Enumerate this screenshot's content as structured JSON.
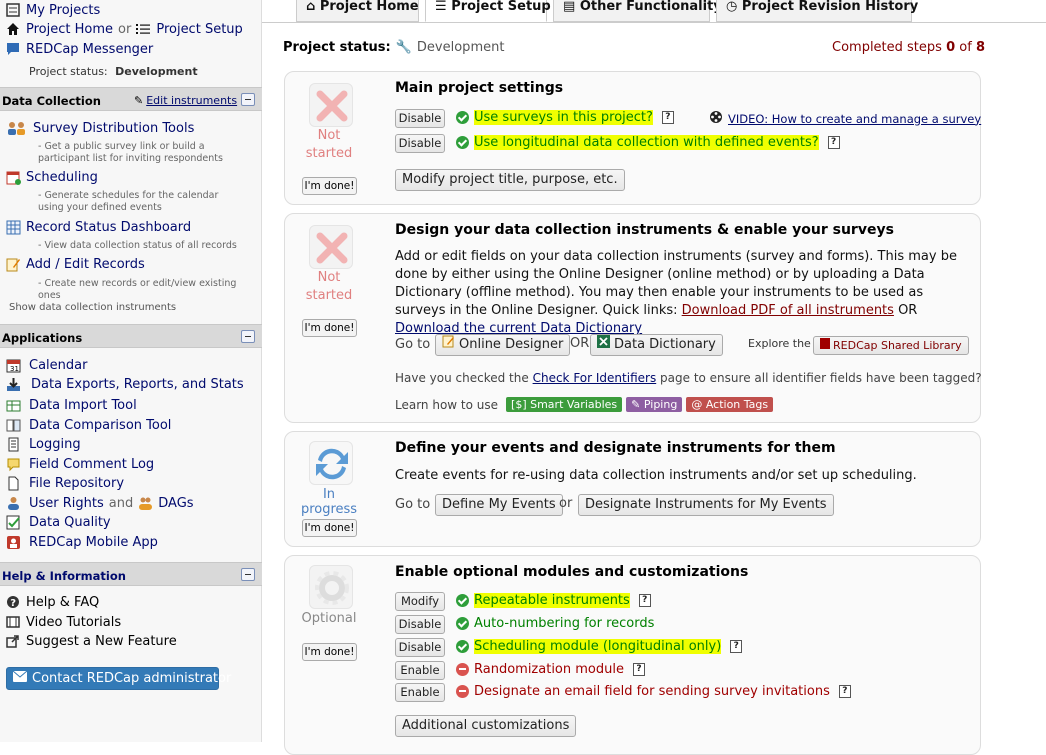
{
  "sidebar": {
    "my_projects": "My Projects",
    "project_home": "Project Home",
    "or": "or",
    "project_setup": "Project Setup",
    "messenger": "REDCap Messenger",
    "status_label": "Project status:",
    "status_value": "Development",
    "data_collection": {
      "header": "Data Collection",
      "edit_link": "Edit instruments",
      "items": [
        {
          "label": "Survey Distribution Tools",
          "sub": "- Get a public survey link or build a participant list for inviting respondents"
        },
        {
          "label": "Scheduling",
          "sub": "- Generate schedules for the calendar using your defined events"
        },
        {
          "label": "Record Status Dashboard",
          "sub": "- View data collection status of all records"
        },
        {
          "label": "Add / Edit Records",
          "sub": "- Create new records or edit/view existing ones"
        }
      ],
      "show_instruments": "Show data collection instruments"
    },
    "applications": {
      "header": "Applications",
      "items": [
        "Calendar",
        "Data Exports, Reports, and Stats",
        "Data Import Tool",
        "Data Comparison Tool",
        "Logging",
        "Field Comment Log",
        "File Repository",
        "User Rights",
        "Data Quality",
        "REDCap Mobile App"
      ],
      "and": "and",
      "dags": "DAGs"
    },
    "help": {
      "header": "Help & Information",
      "items": [
        "Help & FAQ",
        "Video Tutorials",
        "Suggest a New Feature"
      ],
      "contact": "Contact REDCap administrator"
    }
  },
  "tabs": [
    "Project Home",
    "Project Setup",
    "Other Functionality",
    "Project Revision History"
  ],
  "status_bar": {
    "label": "Project status:",
    "value": "Development",
    "completed_prefix": "Completed steps",
    "completed": "0",
    "of": "of",
    "total": "8"
  },
  "panels": {
    "main": {
      "title": "Main project settings",
      "status": [
        "Not",
        "started"
      ],
      "done": "I'm done!",
      "rows": [
        {
          "button": "Disable",
          "text": "Use surveys in this project?"
        },
        {
          "button": "Disable",
          "text": "Use longitudinal data collection with defined events?"
        }
      ],
      "video": "VIDEO: How to create and manage a survey",
      "modify": "Modify project title, purpose, etc."
    },
    "design": {
      "title": "Design your data collection instruments & enable your surveys",
      "status": [
        "Not",
        "started"
      ],
      "done": "I'm done!",
      "paragraph": "Add or edit fields on your data collection instruments (survey and forms). This may be done by either using the Online Designer (online method) or by uploading a Data Dictionary (offline method). You may then enable your instruments to be used as surveys in the Online Designer.",
      "quick_links": "Quick links:",
      "pdf_link": "Download PDF of all instruments",
      "or": "OR",
      "dict_link": "Download the current Data Dictionary",
      "goto": "Go to",
      "online_designer": "Online Designer",
      "data_dictionary": "Data Dictionary",
      "explore": "Explore the",
      "shared_library": "REDCap Shared Library",
      "identifiers_pre": "Have you checked the",
      "identifiers_link": "Check For Identifiers",
      "identifiers_post": "page to ensure all identifier fields have been tagged?",
      "learn": "Learn how to use",
      "smart_variables": "Smart Variables",
      "piping": "Piping",
      "action_tags": "Action Tags"
    },
    "events": {
      "title": "Define your events and designate instruments for them",
      "status": "In progress",
      "done": "I'm done!",
      "paragraph": "Create events for re-using data collection instruments and/or set up scheduling.",
      "goto": "Go to",
      "define": "Define My Events",
      "or": "or",
      "designate": "Designate Instruments for My Events"
    },
    "optional": {
      "title": "Enable optional modules and customizations",
      "status": "Optional",
      "done": "I'm done!",
      "rows": [
        {
          "button": "Modify",
          "text": "Repeatable instruments",
          "state": "on"
        },
        {
          "button": "Disable",
          "text": "Auto-numbering for records",
          "state": "on"
        },
        {
          "button": "Disable",
          "text": "Scheduling module (longitudinal only)",
          "state": "on"
        },
        {
          "button": "Enable",
          "text": "Randomization module",
          "state": "off"
        },
        {
          "button": "Enable",
          "text": "Designate an email field for sending survey invitations",
          "state": "off"
        }
      ],
      "additional": "Additional customizations"
    }
  },
  "colors": {
    "link": "#000a6d",
    "green": "#008000",
    "red": "#a00000",
    "highlight": "#f0ff00",
    "contact_bg": "#337ab7"
  }
}
